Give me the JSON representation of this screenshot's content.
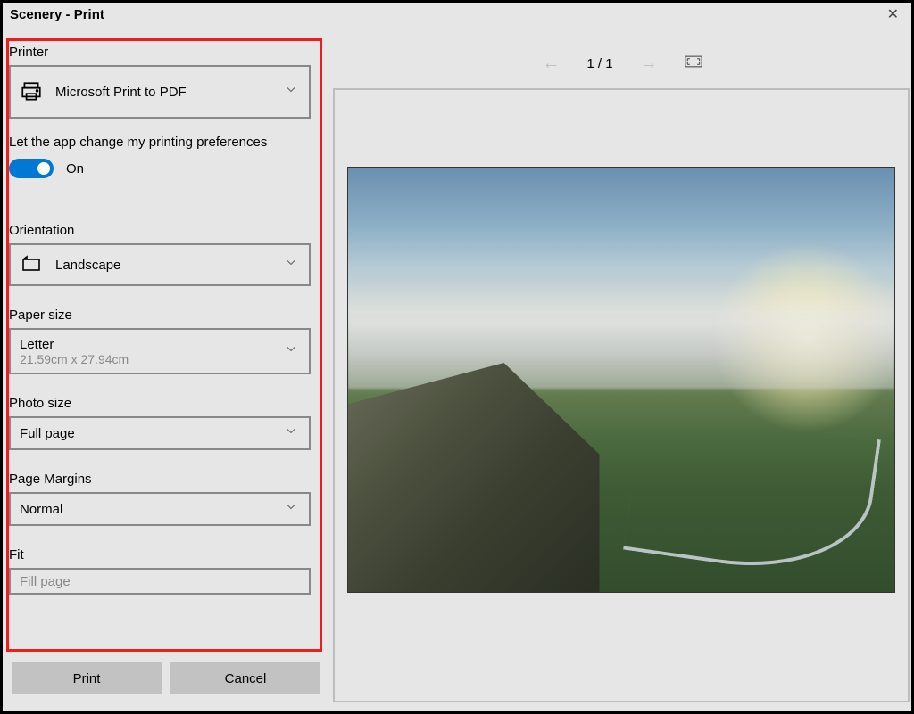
{
  "title": "Scenery - Print",
  "printer": {
    "label": "Printer",
    "value": "Microsoft Print to PDF"
  },
  "prefs": {
    "label": "Let the app change my printing preferences",
    "state": "On"
  },
  "orientation": {
    "label": "Orientation",
    "value": "Landscape"
  },
  "paper": {
    "label": "Paper size",
    "value": "Letter",
    "sub": "21.59cm x 27.94cm"
  },
  "photo": {
    "label": "Photo size",
    "value": "Full page"
  },
  "margins": {
    "label": "Page Margins",
    "value": "Normal"
  },
  "fit": {
    "label": "Fit",
    "value": "Fill page"
  },
  "buttons": {
    "print": "Print",
    "cancel": "Cancel"
  },
  "nav": {
    "count": "1 / 1"
  }
}
